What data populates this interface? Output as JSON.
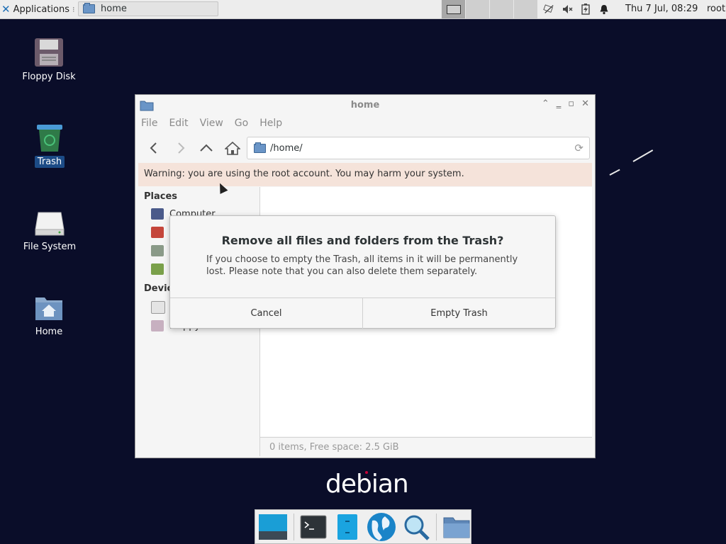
{
  "top_panel": {
    "applications_label": "Applications",
    "task_home_label": "home",
    "clock": "Thu  7 Jul, 08:29",
    "user": "root"
  },
  "desktop": {
    "icons": [
      {
        "label": "Floppy Disk"
      },
      {
        "label": "Trash"
      },
      {
        "label": "File System"
      },
      {
        "label": "Home"
      }
    ]
  },
  "file_manager": {
    "title": "home",
    "menu": [
      "File",
      "Edit",
      "View",
      "Go",
      "Help"
    ],
    "location": "/home/",
    "warning": "Warning: you are using the root account. You may harm your system.",
    "sidebar": {
      "places_header": "Places",
      "places": [
        "Computer"
      ],
      "devices_header": "Devices",
      "devices": [
        "Floppy Disk"
      ]
    },
    "status": "0 items, Free space: 2.5 GiB"
  },
  "dialog": {
    "title": "Remove all files and folders from the Trash?",
    "body": "If you choose to empty the Trash, all items in it will be permanently lost. Please note that you can also delete them separately.",
    "cancel_label": "Cancel",
    "confirm_label": "Empty Trash"
  },
  "debian_logo_text": "debian",
  "colors": {
    "desktop_bg": "#0a0d29",
    "warning_bg": "#f5e3da",
    "selection_bg": "#1c4b86",
    "debian_red": "#c70036"
  }
}
